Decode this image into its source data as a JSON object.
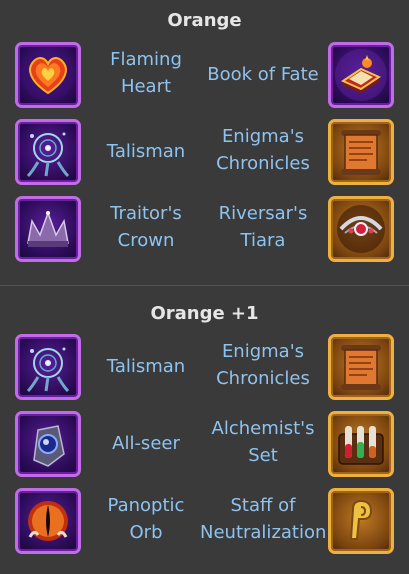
{
  "sections": [
    {
      "title": "Orange",
      "rows": [
        {
          "left": {
            "name": "Flaming Heart",
            "line1": "Flaming",
            "line2": "Heart",
            "frame": "purple",
            "icon": "flaming-heart-icon"
          },
          "right": {
            "name": "Book of Fate",
            "line1": "Book of Fate",
            "line2": "",
            "frame": "purple",
            "icon": "book-of-fate-icon"
          }
        },
        {
          "left": {
            "name": "Talisman",
            "line1": "Talisman",
            "line2": "",
            "frame": "purple",
            "icon": "talisman-icon"
          },
          "right": {
            "name": "Enigma's Chronicles",
            "line1": "Enigma's",
            "line2": "Chronicles",
            "frame": "orange",
            "icon": "scroll-icon"
          }
        },
        {
          "left": {
            "name": "Traitor's Crown",
            "line1": "Traitor's",
            "line2": "Crown",
            "frame": "purple",
            "icon": "crown-icon"
          },
          "right": {
            "name": "Riversar's Tiara",
            "line1": "Riversar's",
            "line2": "Tiara",
            "frame": "orange",
            "icon": "tiara-icon"
          }
        }
      ]
    },
    {
      "title": "Orange +1",
      "rows": [
        {
          "left": {
            "name": "Talisman",
            "line1": "Talisman",
            "line2": "",
            "frame": "purple",
            "icon": "talisman-icon"
          },
          "right": {
            "name": "Enigma's Chronicles",
            "line1": "Enigma's",
            "line2": "Chronicles",
            "frame": "orange",
            "icon": "scroll-icon"
          }
        },
        {
          "left": {
            "name": "All-seer",
            "line1": "All-seer",
            "line2": "",
            "frame": "purple",
            "icon": "all-seer-icon"
          },
          "right": {
            "name": "Alchemist's Set",
            "line1": "Alchemist's",
            "line2": "Set",
            "frame": "orange",
            "icon": "alchemist-set-icon"
          }
        },
        {
          "left": {
            "name": "Panoptic Orb",
            "line1": "Panoptic",
            "line2": "Orb",
            "frame": "purple",
            "icon": "panoptic-orb-icon"
          },
          "right": {
            "name": "Staff of Neutralization",
            "line1": "Staff of",
            "line2": "Neutralization",
            "frame": "orange",
            "icon": "staff-icon"
          }
        }
      ]
    }
  ]
}
